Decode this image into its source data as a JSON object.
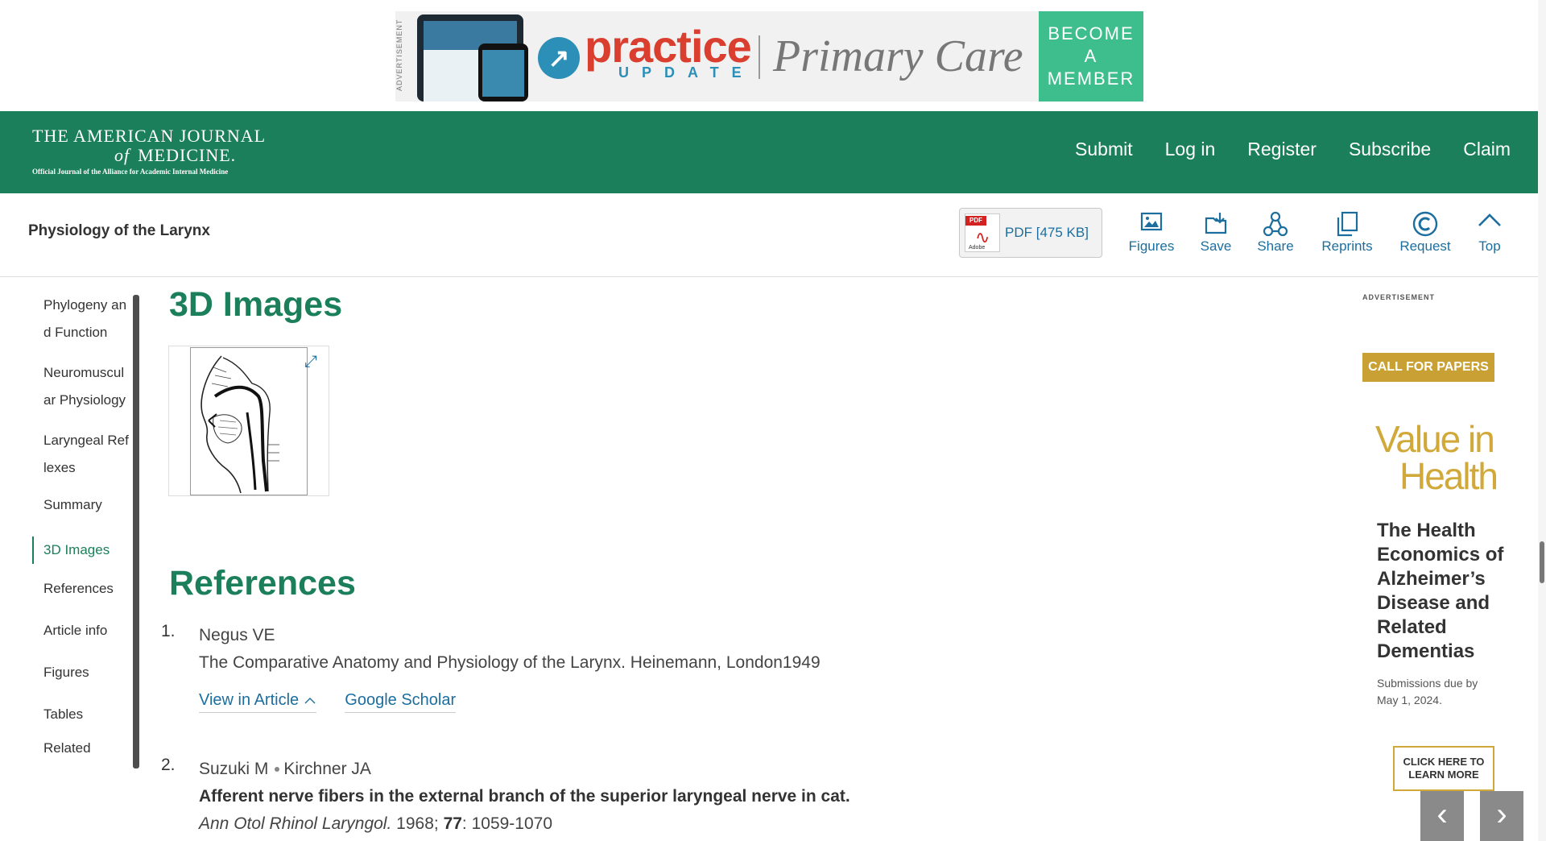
{
  "ad_top": {
    "vertical_label": "ADVERTISEMENT",
    "brand": "practice",
    "brand_sub": "UPDATE",
    "product": "Primary Care",
    "cta": "BECOME A MEMBER"
  },
  "header": {
    "logo_line1": "THE AMERICAN JOURNAL",
    "logo_of": "of",
    "logo_line2": "MEDICINE.",
    "logo_tagline": "Official Journal of the Alliance for Academic Internal Medicine",
    "nav": [
      "Submit",
      "Log in",
      "Register",
      "Subscribe",
      "Claim"
    ]
  },
  "article_bar": {
    "title": "Physiology of the Larynx",
    "pdf_label": "PDF [475 KB]",
    "pdf_tag": "PDF",
    "pdf_adobe": "Adobe",
    "tools": [
      "Figures",
      "Save",
      "Share",
      "Reprints",
      "Request",
      "Top"
    ]
  },
  "side_nav": {
    "items": [
      "Phylogeny and Function",
      "Neuromuscular Physiology",
      "Laryngeal Reflexes",
      "Summary",
      "3D Images",
      "References",
      "Article info",
      "Figures",
      "Tables",
      "Related"
    ],
    "active": "3D Images"
  },
  "main": {
    "images_heading": "3D Images",
    "references_heading": "References",
    "references": [
      {
        "num": "1.",
        "authors": [
          "Negus VE"
        ],
        "title": "",
        "text": "The Comparative Anatomy and Physiology of the Larynx. Heinemann, London1949",
        "links": [
          "View in Article",
          "Google Scholar"
        ]
      },
      {
        "num": "2.",
        "authors": [
          "Suzuki M",
          "Kirchner JA"
        ],
        "title": "Afferent nerve fibers in the external branch of the superior laryngeal nerve in cat.",
        "journal": "Ann Otol Rhinol Laryngol.",
        "year": "1968;",
        "volume": "77",
        "pages": ": 1059-1070"
      }
    ]
  },
  "ad_right": {
    "label": "ADVERTISEMENT",
    "cfp": "CALL FOR PAPERS",
    "brand_line1": "Value in",
    "brand_line2": "Health",
    "title": "The Health Economics of Alzheimer’s Disease and Related Dementias",
    "sub": "Submissions due by May 1, 2024.",
    "button": "CLICK HERE TO LEARN MORE"
  },
  "carousel": {
    "prev": "‹",
    "next": "›"
  },
  "colors": {
    "brand_green": "#1a7f5a",
    "link_blue": "#1c6e9e",
    "ad_gold": "#c9a033"
  }
}
